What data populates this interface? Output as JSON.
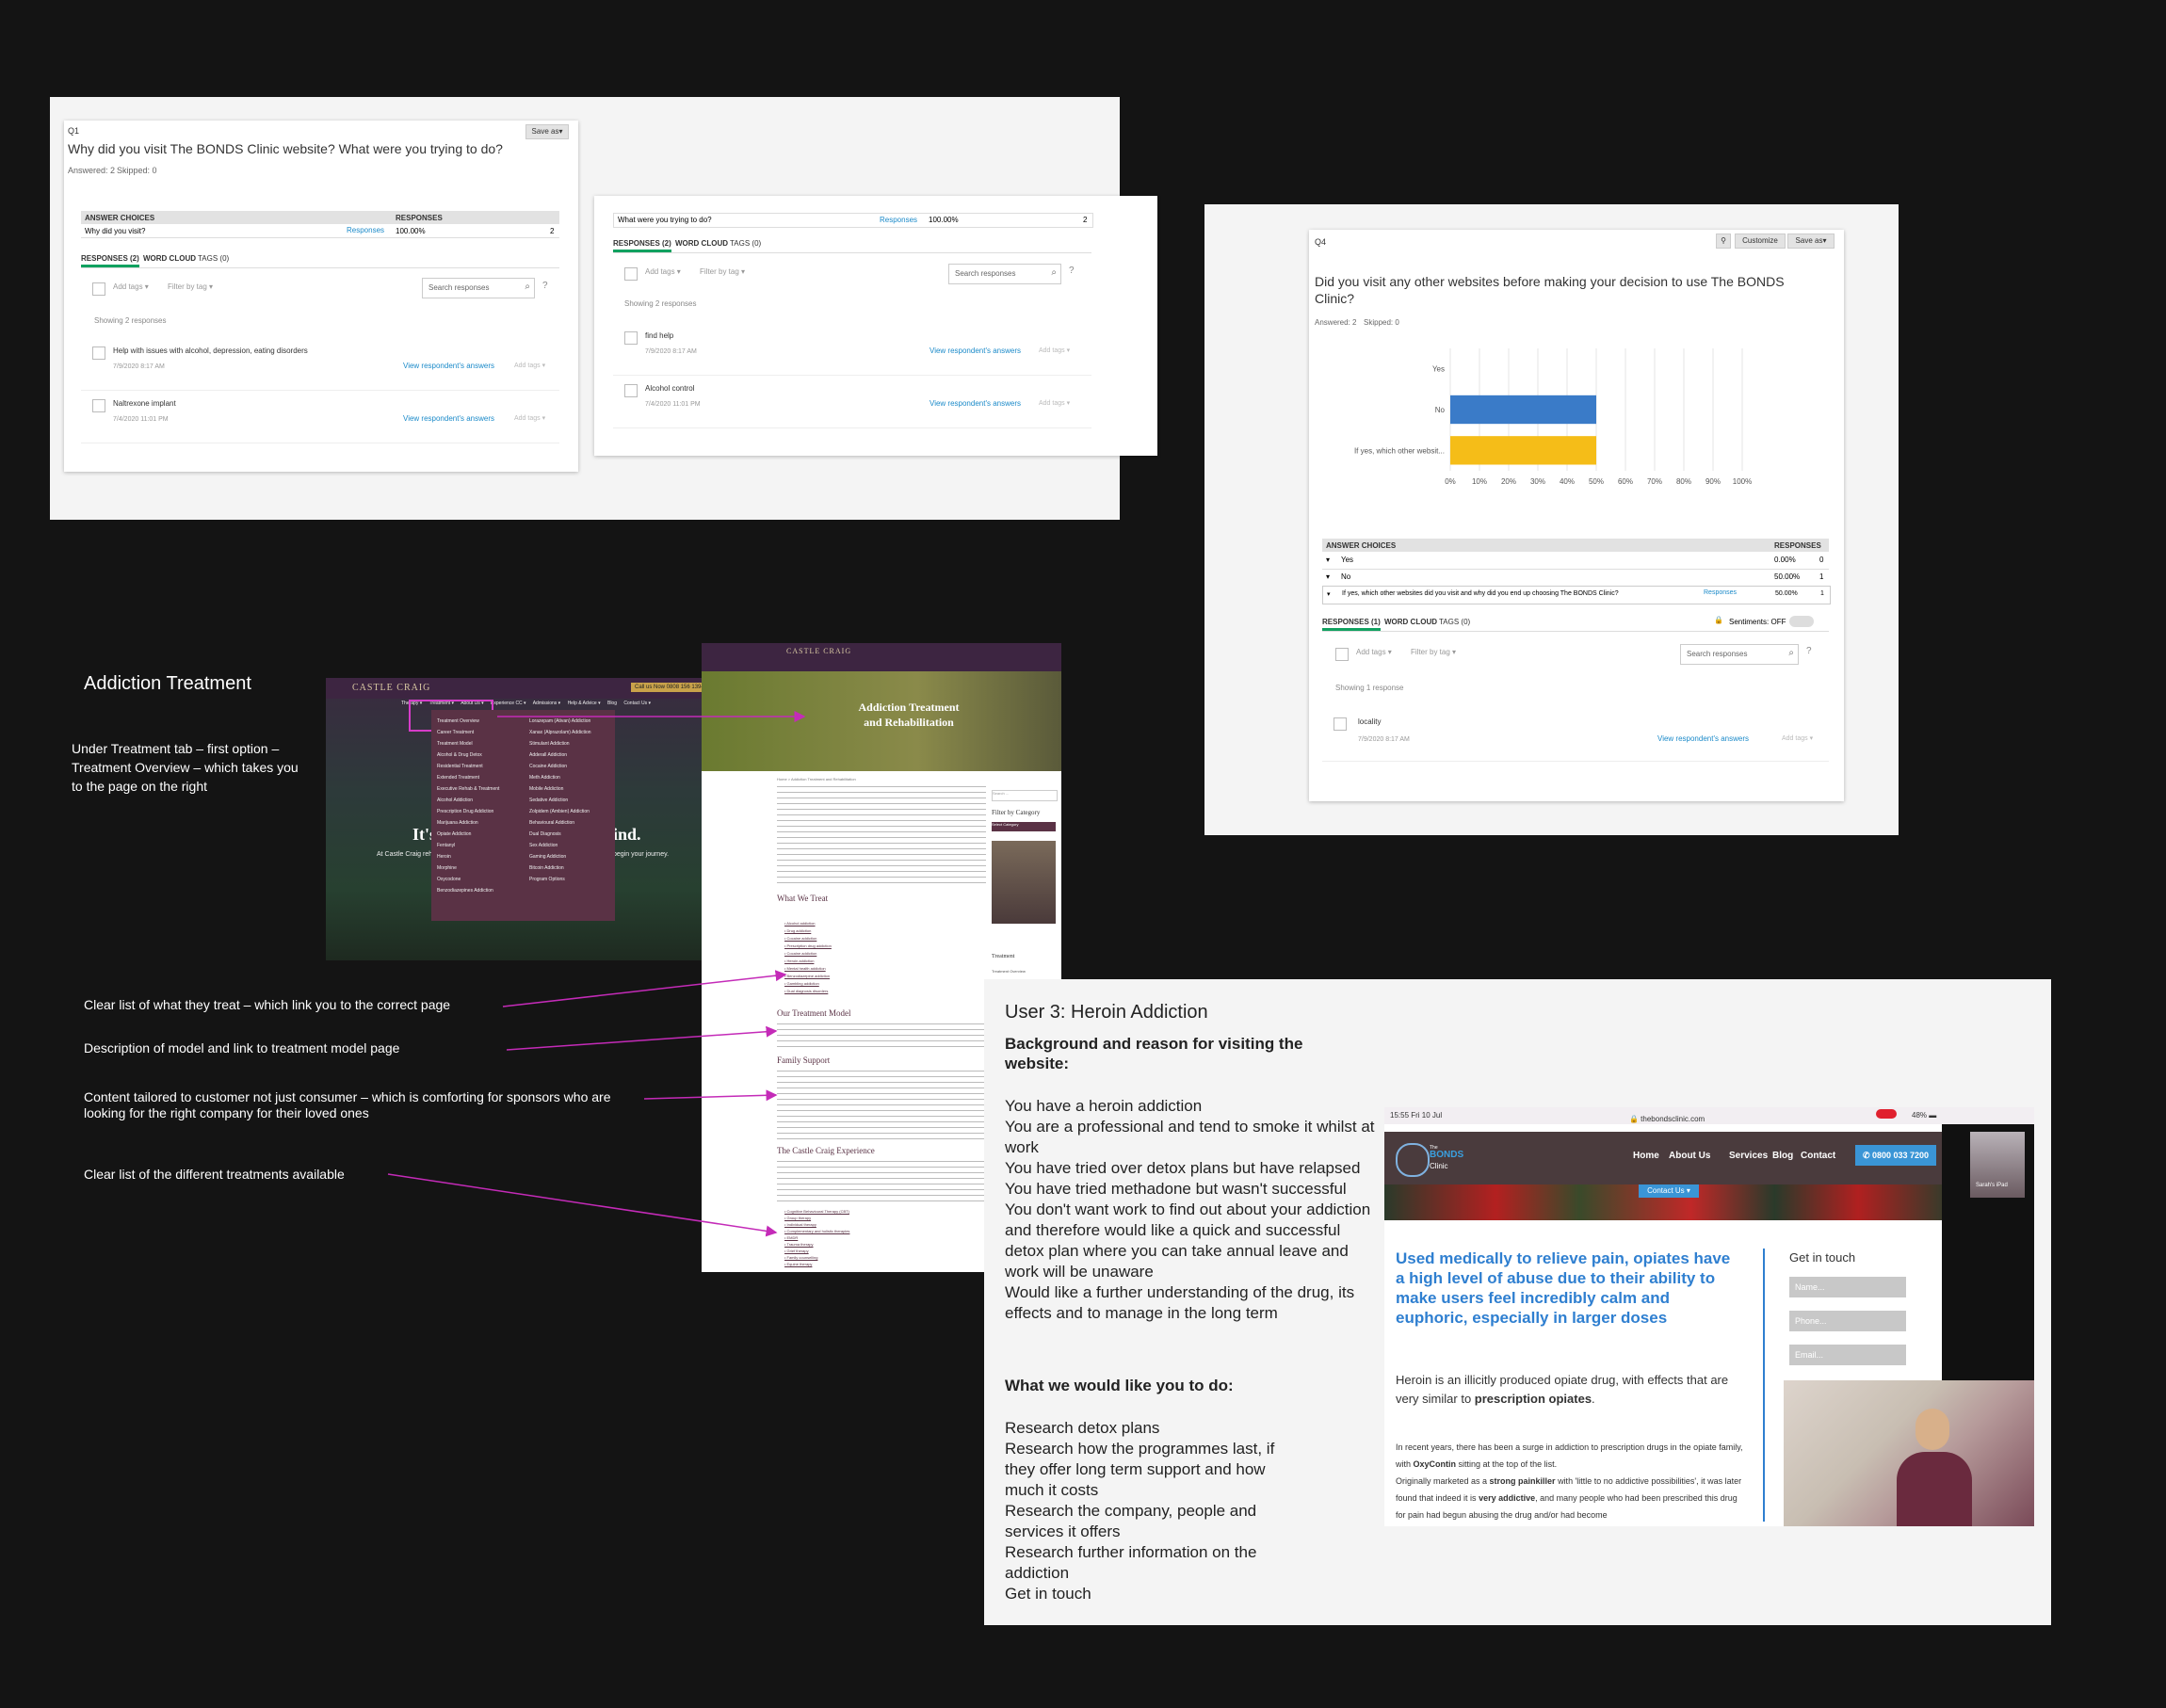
{
  "q1": {
    "number": "Q1",
    "save_as": "Save as▾",
    "question": "Why did you visit The BONDS Clinic website? What were you trying to do?",
    "answered": "Answered: 2",
    "skipped": "Skipped: 0",
    "col_choices": "ANSWER CHOICES",
    "col_responses": "RESPONSES",
    "row_label": "Why did you visit?",
    "row_link": "Responses",
    "row_value": "100.00%",
    "row_count": "2",
    "tab_responses": "RESPONSES (2)",
    "tab_wordcloud": "WORD CLOUD",
    "tab_tags": "TAGS (0)",
    "add_tags": "Add tags ▾",
    "filter_tag": "Filter by tag ▾",
    "search_placeholder": "Search responses",
    "showing": "Showing 2 responses",
    "responses": [
      {
        "text": "Help with issues with alcohol, depression, eating disorders",
        "date": "7/9/2020 8:17 AM",
        "link": "View respondent's answers",
        "tags": "Add tags ▾"
      },
      {
        "text": "Naltrexone implant",
        "date": "7/4/2020 11:01 PM",
        "link": "View respondent's answers",
        "tags": "Add tags ▾"
      }
    ]
  },
  "q1b": {
    "row_label": "What were you trying to do?",
    "row_link": "Responses",
    "row_value": "100.00%",
    "row_count": "2",
    "tab_responses": "RESPONSES (2)",
    "tab_wordcloud": "WORD CLOUD",
    "tab_tags": "TAGS (0)",
    "add_tags": "Add tags ▾",
    "filter_tag": "Filter by tag ▾",
    "search_placeholder": "Search responses",
    "showing": "Showing 2 responses",
    "responses": [
      {
        "text": "find help",
        "date": "7/9/2020 8:17 AM",
        "link": "View respondent's answers",
        "tags": "Add tags ▾"
      },
      {
        "text": "Alcohol control",
        "date": "7/4/2020 11:01 PM",
        "link": "View respondent's answers",
        "tags": "Add tags ▾"
      }
    ]
  },
  "q4": {
    "number": "Q4",
    "customize": "Customize",
    "save_as": "Save as▾",
    "question": "Did you visit any other websites before making your decision to use The BONDS Clinic?",
    "answered": "Answered: 2",
    "skipped": "Skipped: 0",
    "col_choices": "ANSWER CHOICES",
    "col_responses": "RESPONSES",
    "rows": [
      {
        "label": "Yes",
        "pct": "0.00%",
        "count": "0"
      },
      {
        "label": "No",
        "pct": "50.00%",
        "count": "1"
      },
      {
        "label": "If yes, which other websites did you visit and why did you end up choosing The BONDS Clinic?",
        "link": "Responses",
        "pct": "50.00%",
        "count": "1"
      }
    ],
    "tab_responses": "RESPONSES (1)",
    "tab_wordcloud": "WORD CLOUD",
    "tab_tags": "TAGS (0)",
    "sentiments": "Sentiments: OFF",
    "add_tags": "Add tags ▾",
    "filter_tag": "Filter by tag ▾",
    "search_placeholder": "Search responses",
    "showing": "Showing 1 response",
    "response": {
      "text": "locality",
      "date": "7/9/2020 8:17 AM",
      "link": "View respondent's answers",
      "tags": "Add tags ▾"
    }
  },
  "chart_data": {
    "type": "bar",
    "orientation": "horizontal",
    "categories": [
      "Yes",
      "No",
      "If yes, which other websit..."
    ],
    "values": [
      0,
      50,
      50
    ],
    "colors": [
      "#3a7bc8",
      "#3a7bc8",
      "#f5bd18"
    ],
    "xlim": [
      0,
      100
    ],
    "ticks": [
      "0%",
      "10%",
      "20%",
      "30%",
      "40%",
      "50%",
      "60%",
      "70%",
      "80%",
      "90%",
      "100%"
    ],
    "grid": true
  },
  "addiction": {
    "title": "Addiction Treatment",
    "intro": "Under Treatment tab – first option – Treatment Overview – which takes you to the page on the right",
    "notes": [
      "Clear list of what they treat – which link you to the correct page",
      "Description of model and link to treatment model page",
      "Content tailored to customer not just consumer – which is comforting for sponsors who are looking for the right company for their loved ones",
      "Clear list of the different treatments available"
    ],
    "castle_brand": "CASTLE CRAIG",
    "call_btn": "Call us Now 0808 156 1394",
    "nav": [
      "Therapy ▾",
      "Treatment ▾",
      "About Us ▾",
      "Experience CC ▾",
      "Admissions ▾",
      "Help & Advice ▾",
      "Blog",
      "Contact Us ▾"
    ],
    "menu_left": [
      "Treatment Overview",
      "Career Treatment",
      "Treatment Model",
      "Alcohol & Drug Detox",
      "Residential Treatment",
      "Extended Treatment",
      "Executive Rehab & Treatment",
      "Alcohol Addiction",
      "Prescription Drug Addiction",
      "Marijuana Addiction",
      "Opiate Addiction",
      "Fentanyl",
      "Heroin",
      "Morphine",
      "Oxycodone",
      "Benzodiazepines Addiction"
    ],
    "menu_right": [
      "Lorazepam (Ativan) Addiction",
      "Xanax (Alprazolam) Addiction",
      "Stimulant Addiction",
      "Adderall Addiction",
      "Cocaine Addiction",
      "Meth Addiction",
      "Mobile Addiction",
      "Sedative Addiction",
      "Zolpidem (Ambien) Addiction",
      "Behavioural Addiction",
      "Dual Diagnosis",
      "Sex Addiction",
      "Gaming Addiction",
      "Bitcoin Addiction",
      "Program Options"
    ],
    "hero_text": "It's",
    "hero_text2": "ind.",
    "hero_sub": "At Castle Craig reh",
    "hero_sub2": "begin your journey.",
    "page_title": "Addiction Treatment and Rehabilitation",
    "crumb": "Home > Addiction Treatment and Rehabilitation",
    "sidebar_search": "Search ...",
    "filter_cat": "Filter by Category",
    "select_cat": "Select Category",
    "sidebar_treatment": "Treatment",
    "sidebar_links": [
      "Treatment Overview",
      "Career Treatment"
    ],
    "h_what": "What We Treat",
    "treat_list": [
      "Alcohol addiction",
      "Drug addiction",
      "Cocaine addiction",
      "Prescription drug addiction",
      "Cocaine addiction",
      "Heroin addiction",
      "Mental health addiction",
      "Benzodiazepine addiction",
      "Gambling addiction",
      "Dual diagnosis disorders"
    ],
    "h_model": "Our Treatment Model",
    "h_family": "Family Support",
    "h_exp": "The Castle Craig Experience",
    "exp_list": [
      "Cognitive Behavioural Therapy (CBT)",
      "Group therapy",
      "Individual therapy",
      "Complementary and holistic therapies",
      "EMDR",
      "Trauma therapy",
      "Grief therapy",
      "Family counselling",
      "Equine therapy"
    ]
  },
  "user3": {
    "title": "User 3: Heroin Addiction",
    "bg_heading": "Background and reason for visiting the website:",
    "bg_lines": [
      "You have a heroin addiction",
      "You are a professional and tend to smoke it whilst at work",
      "You have tried over detox plans but have relapsed",
      "You have tried methadone but wasn't successful",
      "You don't want work to find out about your addiction and therefore would like a quick and successful detox plan where you can take annual leave and work will be unaware",
      "Would like a further understanding of the drug, its effects and to manage in the long term"
    ],
    "todo_heading": "What we would like you to do:",
    "todo_lines": [
      "Research detox plans",
      "Research how the programmes last, if they offer long term support and how much it costs",
      "Research the company, people and services it offers",
      "Research further information on the addiction",
      "Get in touch"
    ]
  },
  "ipad": {
    "time": "15:55  Fri 10 Jul",
    "url": "🔒 thebondsclinic.com",
    "battery": "48% ▬",
    "brand_small": "The",
    "brand": "BONDS",
    "brand_sub": "Clinic",
    "nav": [
      "Home",
      "About Us",
      "Services",
      "Blog",
      "Contact"
    ],
    "phone": "✆ 0800 033 7200",
    "contact_btn": "Contact Us ▾",
    "headline": "Used medically to relieve pain, opiates have a high level of abuse due to their ability to make users feel incredibly calm and euphoric, especially in larger doses",
    "para1_a": "Heroin is an illicitly produced opiate drug, with effects that are very similar to ",
    "para1_b": "prescription opiates",
    "para1_c": ".",
    "para2_a": "In recent years, there has been a surge in addiction to prescription drugs in the opiate family, with ",
    "para2_b": "OxyContin",
    "para2_c": " sitting at the top of the list.",
    "para3_a": "Originally marketed as a ",
    "para3_b": "strong painkiller",
    "para3_c": " with 'little to no addictive possibilities', it was later found that indeed it is ",
    "para3_d": "very addictive",
    "para3_e": ", and many people who had been prescribed this drug for pain had begun abusing the drug and/or had become",
    "get_in_touch": "Get in touch",
    "field_name": "Name...",
    "field_phone": "Phone...",
    "field_email": "Email...",
    "video_label": "Sarah's iPad"
  }
}
